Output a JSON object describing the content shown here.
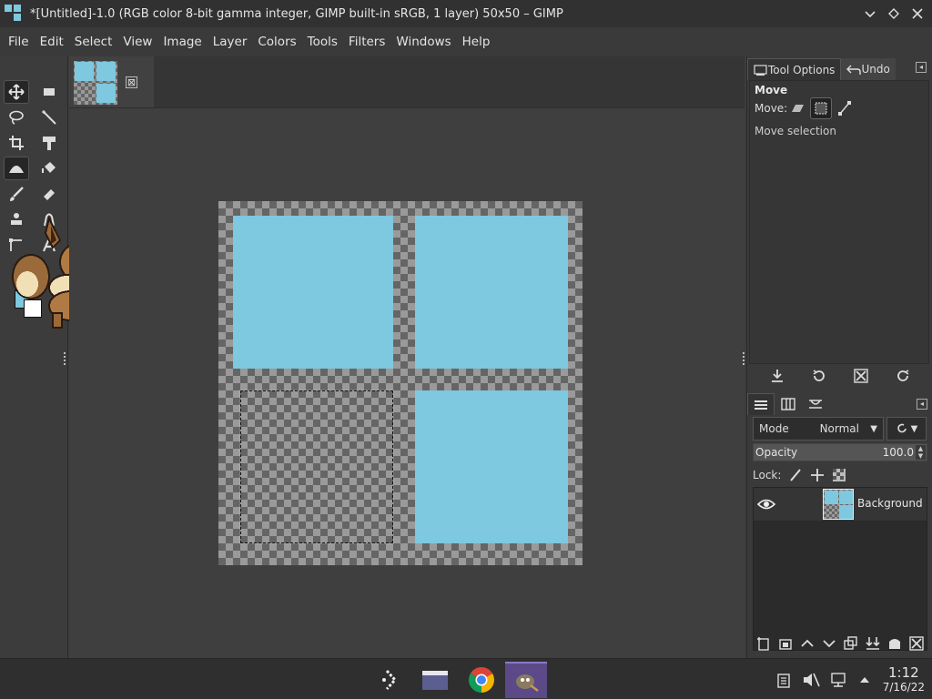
{
  "window": {
    "title": "*[Untitled]-1.0 (RGB color 8-bit gamma integer, GIMP built-in sRGB, 1 layer) 50x50 – GIMP",
    "controls": [
      "chevron-down-icon",
      "restore-icon",
      "close-icon"
    ]
  },
  "menubar": {
    "items": [
      "File",
      "Edit",
      "Select",
      "View",
      "Image",
      "Layer",
      "Colors",
      "Tools",
      "Filters",
      "Windows",
      "Help"
    ]
  },
  "toolbox": {
    "tools": [
      "move-tool",
      "rect-select-tool",
      "lasso-tool",
      "fuzzy-select-tool",
      "crop-tool",
      "unified-transform-tool",
      "warp-transform-tool",
      "bucket-fill-tool",
      "paintbrush-tool",
      "eraser-tool",
      "clone-tool",
      "smudge-tool",
      "paths-tool",
      "text-tool"
    ],
    "active_tool": "move-tool",
    "foreground_color": "#7ec8e0",
    "background_color": "#ffffff"
  },
  "image_tab": {
    "close_symbol": "⊠"
  },
  "canvas": {
    "image_size": "50x50",
    "fill_color": "#7ec8e0",
    "filled_quadrants": [
      "top-left",
      "top-right",
      "bottom-right"
    ],
    "selected_quadrant": "bottom-left"
  },
  "dock": {
    "tabs": [
      {
        "label": "Tool Options",
        "icon": "tool-options-icon",
        "active": true
      },
      {
        "label": "Undo",
        "icon": "undo-icon",
        "active": false
      }
    ],
    "tool_options": {
      "title": "Move",
      "move_label": "Move:",
      "move_modes": [
        "layer",
        "selection",
        "path"
      ],
      "active_mode": "selection",
      "mode_description": "Move selection"
    },
    "layers": {
      "mode_label": "Mode",
      "mode_value": "Normal",
      "opacity_label": "Opacity",
      "opacity_value": "100.0",
      "lock_label": "Lock:",
      "items": [
        {
          "name": "Background",
          "visible": true
        }
      ]
    }
  },
  "taskbar": {
    "apps": [
      "app-launcher-icon",
      "file-manager-icon",
      "chrome-icon",
      "gimp-icon"
    ],
    "active_app": "gimp-icon",
    "time": "1:12",
    "date": "7/16/22"
  }
}
